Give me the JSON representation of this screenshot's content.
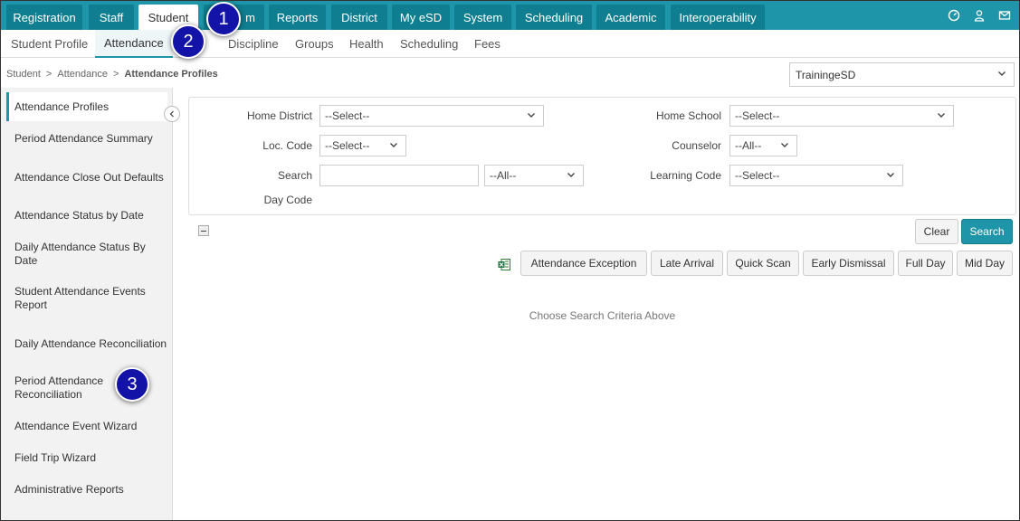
{
  "topnav": {
    "tabs": [
      "Registration",
      "Staff",
      "Student",
      "m",
      "Reports",
      "District",
      "My eSD",
      "System",
      "Scheduling",
      "Academic",
      "Interoperability"
    ],
    "active": "Student",
    "icons": [
      "dashboard-icon",
      "user-icon",
      "mail-icon"
    ]
  },
  "subnav": {
    "tabs": [
      "Student Profile",
      "Attendance",
      "Discipline",
      "Groups",
      "Health",
      "Scheduling",
      "Fees"
    ],
    "active": "Attendance"
  },
  "breadcrumb": {
    "items": [
      "Student",
      "Attendance",
      "Attendance Profiles"
    ],
    "separator": ">"
  },
  "district_select": {
    "value": "TrainingeSD"
  },
  "sidebar": {
    "items": [
      "Attendance Profiles",
      "Period Attendance Summary",
      "Attendance Close Out Defaults",
      "Attendance Status by Date",
      "Daily Attendance Status By Date",
      "Student Attendance Events Report",
      "Daily Attendance Reconciliation",
      "Period Attendance Reconciliation",
      "Attendance Event Wizard",
      "Field Trip Wizard",
      "Administrative Reports"
    ],
    "active": "Attendance Profiles"
  },
  "filters": {
    "home_district_label": "Home District",
    "home_district_value": "--Select--",
    "home_school_label": "Home School",
    "home_school_value": "--Select--",
    "loc_code_label": "Loc. Code",
    "loc_code_value": "--Select--",
    "counselor_label": "Counselor",
    "counselor_value": "--All--",
    "search_label": "Search",
    "search_value": "",
    "search_scope_value": "--All--",
    "learning_code_label": "Learning Code",
    "learning_code_value": "--Select--",
    "day_code_label": "Day Code"
  },
  "actions": {
    "clear": "Clear",
    "search": "Search",
    "quick": [
      "Attendance Exception",
      "Late Arrival",
      "Quick Scan",
      "Early Dismissal",
      "Full Day",
      "Mid Day"
    ]
  },
  "results": {
    "empty_message": "Choose Search Criteria Above"
  },
  "annotations": [
    "1",
    "2",
    "3"
  ],
  "colors": {
    "accent": "#1e95a8",
    "nav_tab": "#0e7e90",
    "badge": "#1313a8"
  }
}
